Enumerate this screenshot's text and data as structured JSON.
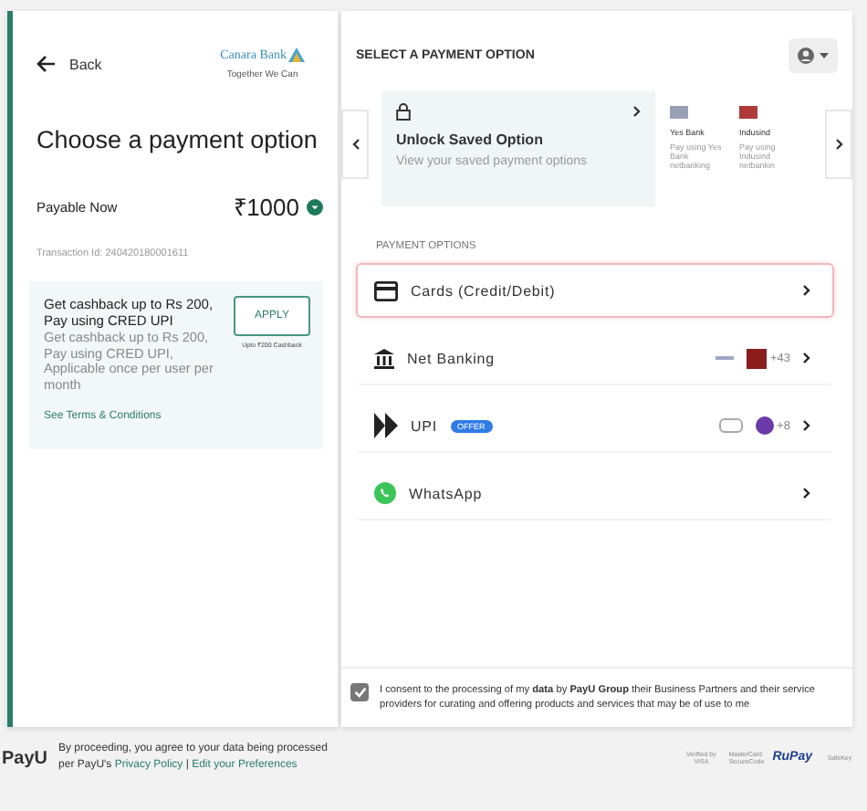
{
  "merchant": {
    "logo_text": "Canara Bank",
    "tagline": "Together We Can"
  },
  "back": {
    "label": "Back"
  },
  "title": "Choose a payment option",
  "payable": {
    "label": "Payable Now",
    "amount": "₹1000"
  },
  "transaction": "Transaction Id: 240420180001611",
  "offer": {
    "heading": "Get cashback up to Rs 200, Pay using CRED UPI",
    "description": "Get cashback up to Rs 200, Pay using CRED UPI, Applicable once per user per month",
    "button": "APPLY",
    "note": "Upto ₹200 Cashback",
    "link": "See Terms & Conditions"
  },
  "header": {
    "title": "SELECT A PAYMENT OPTION"
  },
  "saved": {
    "title": "Unlock Saved Option",
    "subtitle": "View your saved payment options"
  },
  "banks": [
    {
      "name": "Yes Bank",
      "description": "Pay using Yes Bank netbanking",
      "color": "#9aa0b4"
    },
    {
      "name": "Indusind",
      "description": "Pay using Indusind netbankin",
      "color": "#b03a3a"
    }
  ],
  "section_label": "PAYMENT OPTIONS",
  "options": [
    {
      "kind": "card",
      "label": "Cards (Credit/Debit)",
      "selected": true
    },
    {
      "kind": "netbanking",
      "label": "Net Banking",
      "extra": "+43",
      "selected": false
    },
    {
      "kind": "upi",
      "label": "UPI",
      "badge": "OFFER",
      "extra": "+8",
      "selected": false
    },
    {
      "kind": "whatsapp",
      "label": "WhatsApp",
      "selected": false
    }
  ],
  "consent": {
    "checked": true,
    "text": "I consent to the processing of my **data** by **PayU Group** their Business Partners and their service providers for curating and offering products and services that may be of use to me"
  },
  "footer": {
    "logo": "PayU",
    "text": "By proceeding, you agree to your data being processed per PayU's",
    "privacy_link": "Privacy Policy",
    "separator": "|",
    "preferences_link": "Edit your Preferences",
    "badges": [
      "Verified by VISA",
      "MasterCard SecureCode",
      "RuPay",
      "SafeKey"
    ]
  }
}
